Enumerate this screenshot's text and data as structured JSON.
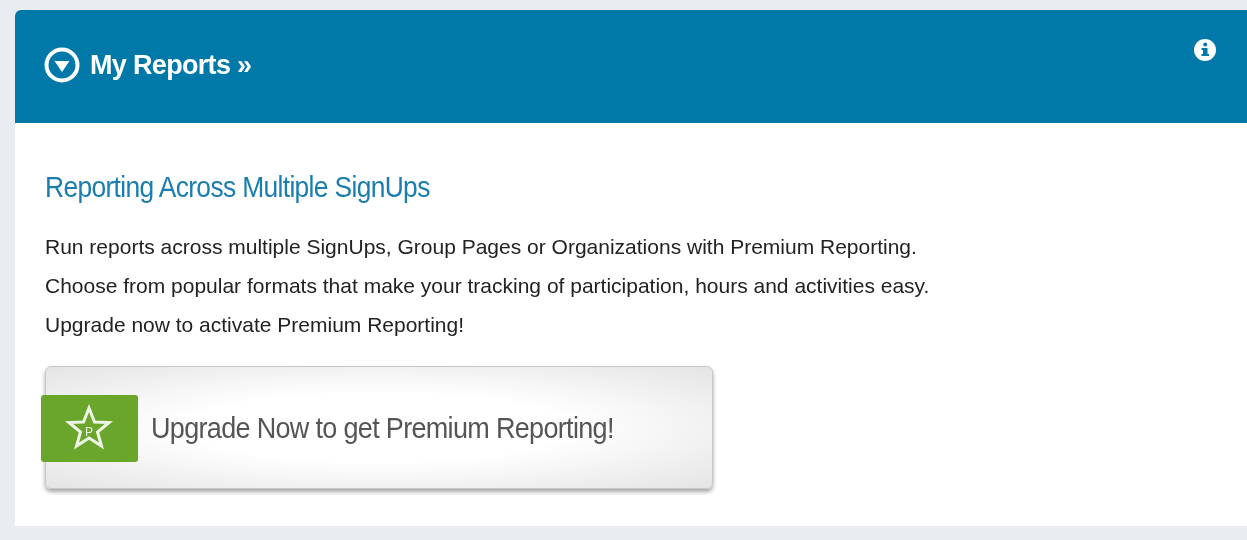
{
  "panel": {
    "title": "My Reports »"
  },
  "content": {
    "heading": "Reporting Across Multiple SignUps",
    "lines": [
      "Run reports across multiple SignUps, Group Pages or Organizations with Premium Reporting.",
      "Choose from popular formats that make your tracking of participation, hours and activities easy.",
      "Upgrade now to activate Premium Reporting!"
    ],
    "upgrade_button": {
      "badge_letter": "P",
      "label": "Upgrade Now to get Premium Reporting!"
    }
  }
}
